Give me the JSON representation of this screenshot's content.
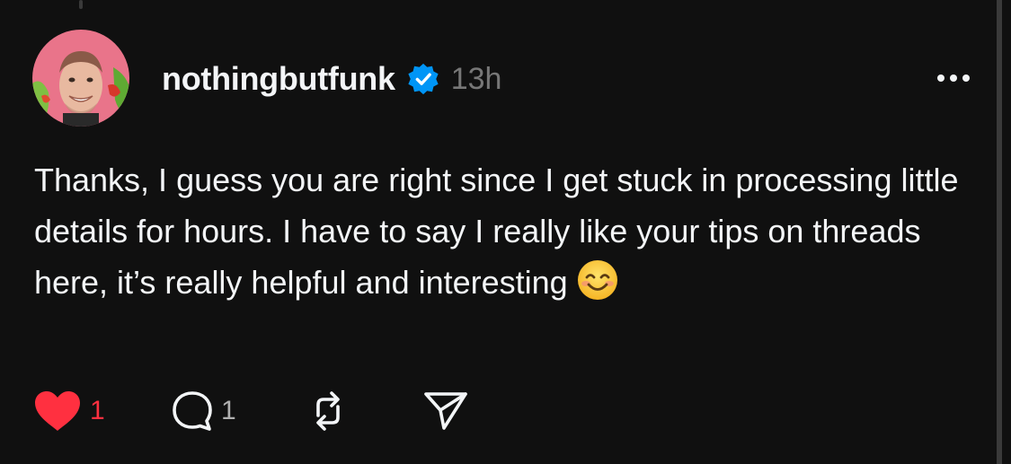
{
  "post": {
    "author": {
      "username": "nothingbutfunk",
      "verified": true,
      "avatar_icon": "profile-photo"
    },
    "time": "13h",
    "text": "Thanks, I guess you are right since I get stuck in processing little details for hours. I have to say I really like your tips on threads here, it’s really helpful and interesting",
    "emoji": "smiling-face-with-smiling-eyes",
    "likes": "1",
    "replies": "1",
    "liked": true
  },
  "icons": {
    "more": "more-icon",
    "like": "heart-icon",
    "reply": "comment-icon",
    "repost": "repost-icon",
    "share": "send-icon",
    "verified": "verified-badge-icon"
  },
  "colors": {
    "background": "#101010",
    "text": "#f3f5f7",
    "muted": "#777777",
    "verified": "#0095f6",
    "like": "#ff3040"
  }
}
